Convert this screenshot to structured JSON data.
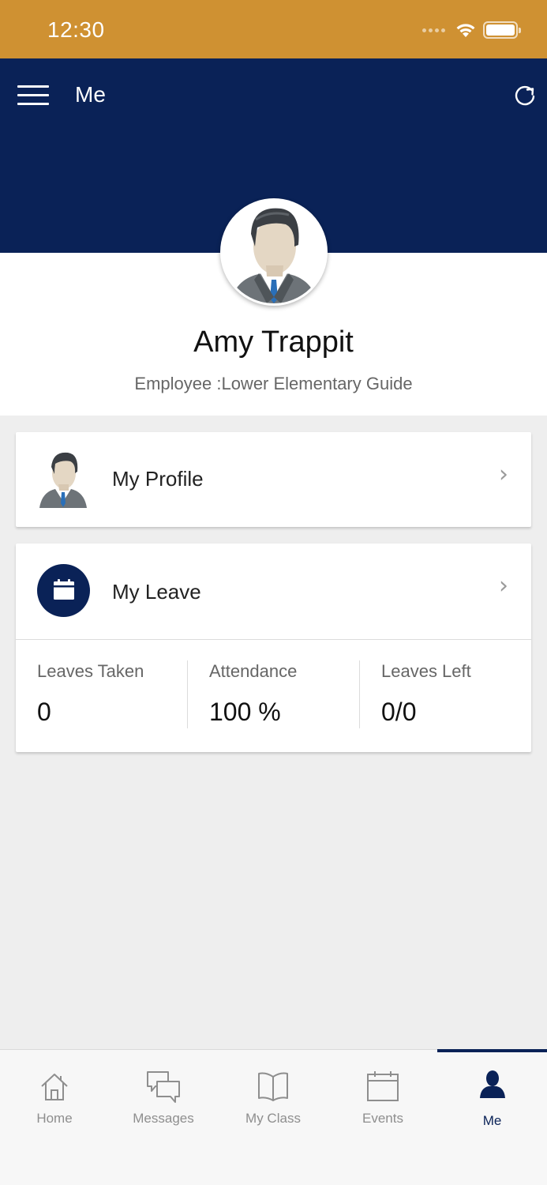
{
  "status_bar": {
    "time": "12:30"
  },
  "header": {
    "title": "Me",
    "menu_icon": "hamburger-menu-icon",
    "refresh_icon": "refresh-icon"
  },
  "profile": {
    "name": "Amy Trappit",
    "role": "Employee :Lower Elementary Guide"
  },
  "cards": {
    "my_profile": {
      "label": "My Profile"
    },
    "my_leave": {
      "label": "My Leave"
    }
  },
  "leave_stats": [
    {
      "label": "Leaves Taken",
      "value": "0"
    },
    {
      "label": "Attendance",
      "value": "100 %"
    },
    {
      "label": "Leaves Left",
      "value": "0/0"
    }
  ],
  "tabs": [
    {
      "label": "Home",
      "icon": "home-icon"
    },
    {
      "label": "Messages",
      "icon": "messages-icon"
    },
    {
      "label": "My Class",
      "icon": "book-icon"
    },
    {
      "label": "Events",
      "icon": "calendar-icon"
    },
    {
      "label": "Me",
      "icon": "person-icon",
      "active": true
    }
  ],
  "colors": {
    "status_bar": "#cf9132",
    "primary": "#0a2257",
    "background": "#eeeeee"
  }
}
